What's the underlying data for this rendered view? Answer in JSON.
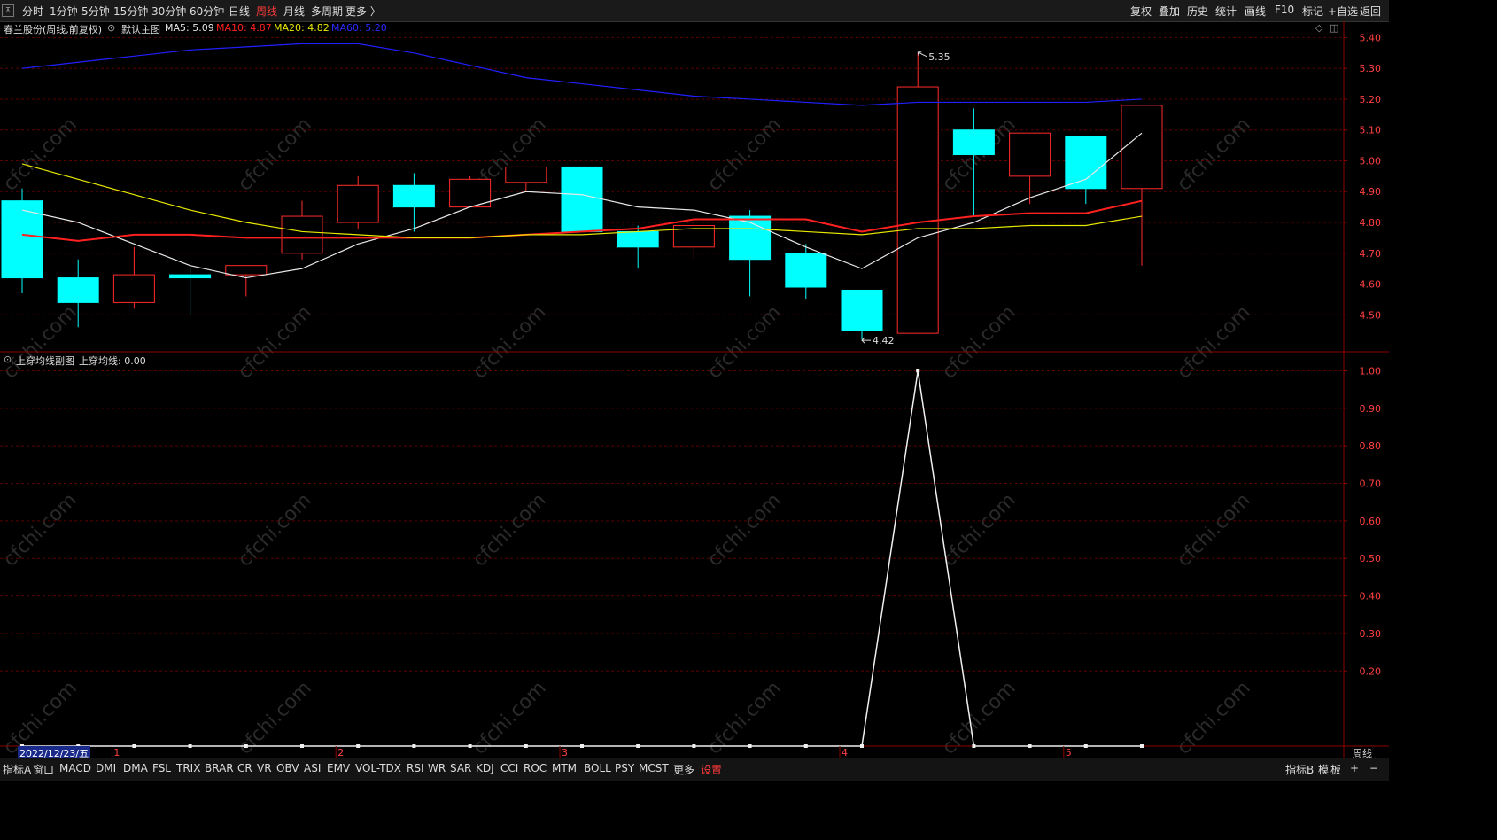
{
  "toolbar": {
    "periods": [
      {
        "label": "分时"
      },
      {
        "label": "1分钟"
      },
      {
        "label": "5分钟"
      },
      {
        "label": "15分钟"
      },
      {
        "label": "30分钟"
      },
      {
        "label": "60分钟"
      },
      {
        "label": "日线"
      },
      {
        "label": "周线",
        "active": true
      },
      {
        "label": "月线"
      },
      {
        "label": "多周期"
      },
      {
        "label": "更多 〉"
      }
    ],
    "right": [
      {
        "label": "复权"
      },
      {
        "label": "叠加"
      },
      {
        "label": "历史"
      },
      {
        "label": "统计"
      },
      {
        "label": "画线"
      },
      {
        "label": "F10"
      },
      {
        "label": "标记"
      },
      {
        "label": "+自选"
      },
      {
        "label": "返回"
      }
    ]
  },
  "main_chart": {
    "stock_title": "春兰股份(周线,前复权)",
    "main_label": "默认主图",
    "ma5": "MA5: 5.09",
    "ma10": "MA10: 4.87",
    "ma20": "MA20: 4.82",
    "ma60": "MA60: 5.20",
    "high_marker": "5.35",
    "low_marker": "4.42"
  },
  "sub_chart": {
    "title": "上穿均线副图",
    "value": "上穿均线: 0.00"
  },
  "watermark": "cfchi.com",
  "period_tag": "周线",
  "date_cursor": "2022/12/23/五",
  "bottom_tabs": [
    "指标A",
    "窗口",
    "MACD",
    "DMI",
    "DMA",
    "FSL",
    "TRIX",
    "BRAR",
    "CR",
    "VR",
    "OBV",
    "ASI",
    "EMV",
    "VOL-TDX",
    "RSI",
    "WR",
    "SAR",
    "KDJ",
    "CCI",
    "ROC",
    "MTM",
    "BOLL",
    "PSY",
    "MCST",
    "更多",
    "设置"
  ],
  "bottom_right": [
    "指标B",
    "模",
    "板",
    "+",
    "−"
  ],
  "colors": {
    "up": "#ff2a2a",
    "down": "#00ffff",
    "ma5": "#e8e8e8",
    "ma10": "#ff2020",
    "ma20": "#e8e800",
    "ma60": "#2020ff",
    "grid": "#5a0000"
  },
  "chart_data": [
    {
      "type": "candlestick",
      "ylim": [
        4.38,
        5.43
      ],
      "y_ticks": [
        4.5,
        4.6,
        4.7,
        4.8,
        4.9,
        5.0,
        5.1,
        5.2,
        5.3,
        5.4
      ],
      "x_marks": [
        {
          "i": 2,
          "label": "1"
        },
        {
          "i": 6,
          "label": "2"
        },
        {
          "i": 10,
          "label": "3"
        },
        {
          "i": 15,
          "label": "4"
        },
        {
          "i": 19,
          "label": "5"
        }
      ],
      "candles": [
        {
          "o": 4.87,
          "c": 4.62,
          "h": 4.91,
          "l": 4.57
        },
        {
          "o": 4.62,
          "c": 4.54,
          "h": 4.68,
          "l": 4.46
        },
        {
          "o": 4.54,
          "c": 4.63,
          "h": 4.72,
          "l": 4.52
        },
        {
          "o": 4.63,
          "c": 4.62,
          "h": 4.65,
          "l": 4.5
        },
        {
          "o": 4.63,
          "c": 4.66,
          "h": 4.66,
          "l": 4.56
        },
        {
          "o": 4.7,
          "c": 4.82,
          "h": 4.87,
          "l": 4.68
        },
        {
          "o": 4.8,
          "c": 4.92,
          "h": 4.95,
          "l": 4.78
        },
        {
          "o": 4.92,
          "c": 4.85,
          "h": 4.96,
          "l": 4.77
        },
        {
          "o": 4.85,
          "c": 4.94,
          "h": 4.95,
          "l": 4.85
        },
        {
          "o": 4.93,
          "c": 4.98,
          "h": 4.98,
          "l": 4.9
        },
        {
          "o": 4.98,
          "c": 4.77,
          "h": 4.98,
          "l": 4.77
        },
        {
          "o": 4.77,
          "c": 4.72,
          "h": 4.79,
          "l": 4.65
        },
        {
          "o": 4.72,
          "c": 4.79,
          "h": 4.81,
          "l": 4.68
        },
        {
          "o": 4.82,
          "c": 4.68,
          "h": 4.84,
          "l": 4.56
        },
        {
          "o": 4.7,
          "c": 4.59,
          "h": 4.73,
          "l": 4.55
        },
        {
          "o": 4.58,
          "c": 4.45,
          "h": 4.58,
          "l": 4.42
        },
        {
          "o": 4.44,
          "c": 5.24,
          "h": 5.35,
          "l": 4.44
        },
        {
          "o": 5.1,
          "c": 5.02,
          "h": 5.17,
          "l": 4.82
        },
        {
          "o": 4.95,
          "c": 5.09,
          "h": 5.09,
          "l": 4.86
        },
        {
          "o": 5.08,
          "c": 4.91,
          "h": 5.08,
          "l": 4.86
        },
        {
          "o": 4.91,
          "c": 5.18,
          "h": 5.18,
          "l": 4.66
        }
      ],
      "series": [
        {
          "name": "MA5",
          "values": [
            4.84,
            4.8,
            4.73,
            4.66,
            4.62,
            4.65,
            4.73,
            4.78,
            4.85,
            4.9,
            4.89,
            4.85,
            4.84,
            4.8,
            4.72,
            4.65,
            4.75,
            4.8,
            4.88,
            4.94,
            5.09
          ]
        },
        {
          "name": "MA10",
          "values": [
            4.76,
            4.74,
            4.76,
            4.76,
            4.75,
            4.75,
            4.75,
            4.75,
            4.75,
            4.76,
            4.77,
            4.78,
            4.81,
            4.81,
            4.81,
            4.77,
            4.8,
            4.82,
            4.83,
            4.83,
            4.87
          ]
        },
        {
          "name": "MA20",
          "values": [
            4.99,
            4.94,
            4.89,
            4.84,
            4.8,
            4.77,
            4.76,
            4.75,
            4.75,
            4.76,
            4.76,
            4.77,
            4.78,
            4.78,
            4.77,
            4.76,
            4.78,
            4.78,
            4.79,
            4.79,
            4.82
          ]
        },
        {
          "name": "MA60",
          "values": [
            5.3,
            5.32,
            5.34,
            5.36,
            5.37,
            5.38,
            5.38,
            5.35,
            5.31,
            5.27,
            5.25,
            5.23,
            5.21,
            5.2,
            5.19,
            5.18,
            5.19,
            5.19,
            5.19,
            5.19,
            5.2
          ]
        }
      ]
    },
    {
      "type": "line",
      "ylim": [
        0.0,
        1.02
      ],
      "y_ticks": [
        0.2,
        0.3,
        0.4,
        0.5,
        0.6,
        0.7,
        0.8,
        0.9,
        1.0
      ],
      "series": [
        {
          "name": "上穿均线",
          "values": [
            0,
            0,
            0,
            0,
            0,
            0,
            0,
            0,
            0,
            0,
            0,
            0,
            0,
            0,
            0,
            0,
            1,
            0,
            0,
            0,
            0
          ]
        }
      ]
    }
  ]
}
